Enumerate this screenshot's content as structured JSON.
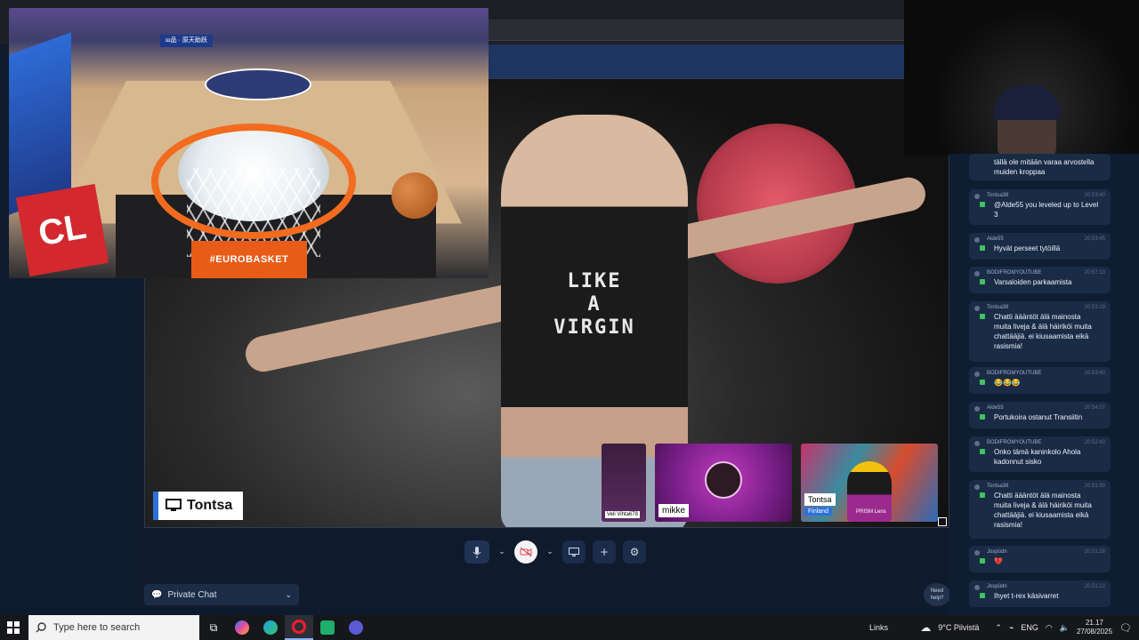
{
  "stage": {
    "shirt_text": "LIKE\nA\nVIRGIN",
    "presenter_name": "Tontsa"
  },
  "participants": [
    {
      "label": "Veli Vihta678"
    },
    {
      "label": "mikke"
    },
    {
      "label": "Tontsa",
      "sublabel": "Finland",
      "overlay": "PRISM Lens"
    }
  ],
  "pip": {
    "sponsor": "ш品 · 原天助跃",
    "base_text": "#EUROBASKET",
    "cl_text": "CL"
  },
  "private_chat": {
    "label": "Private Chat"
  },
  "need_help": "Need help?",
  "chat": {
    "messages": [
      {
        "user": "",
        "time": "",
        "text": "tällä ole mitään varaa arvostella\nmuiden kroppaa"
      },
      {
        "user": "Tontsa38",
        "time": "20:53:40",
        "text": "@Alde55 you leveled up to Level\n3"
      },
      {
        "user": "Alde55",
        "time": "20:53:45",
        "text": "Hyvät perseet tytöillä"
      },
      {
        "user": "BODIFROMYOUTUBE",
        "time": "20:57:13",
        "text": "Varsaloiden parkaamista"
      },
      {
        "user": "Tontsa38",
        "time": "20:53:19",
        "text": "Chatti äääntöt älä mainosta\nmuita liveja & älä häiriköi muita\nchattääjiä. ei kiusaamista eikä\nrasismia!"
      },
      {
        "user": "BODIFROMYOUTUBE",
        "time": "20:53:40",
        "text": "😂😂😂"
      },
      {
        "user": "Alde55",
        "time": "20:54:07",
        "text": "Portukoira ostanut Transiitin"
      },
      {
        "user": "BODIFROMYOUTUBE",
        "time": "20:52:43",
        "text": "Onko tämä kaninkolo Ahola\nkadonnut sisko"
      },
      {
        "user": "Tontsa38",
        "time": "20:51:50",
        "text": "Chatti äääntöt älä mainosta\nmuita liveja & älä häiriköi muita\nchattääjiä. ei kiusaamista eikä\nrasismia!"
      },
      {
        "user": "Jospüdn",
        "time": "20:51:28",
        "text": "💔"
      },
      {
        "user": "Jospüdn",
        "time": "20:51:22",
        "text": "Ihyet t-rex käsivarret"
      }
    ]
  },
  "taskbar": {
    "search_placeholder": "Type here to search",
    "links": "Links",
    "weather": "9°C Pilvistä",
    "lang": "ENG",
    "time": "21.17",
    "date": "27/08/2025"
  }
}
